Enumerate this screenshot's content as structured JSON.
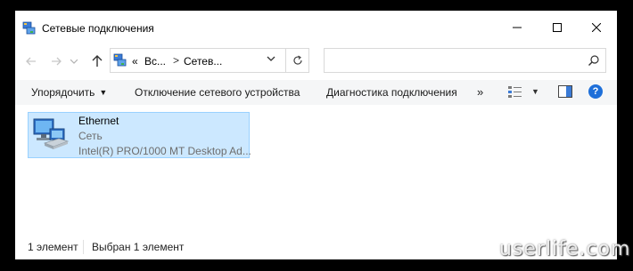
{
  "window": {
    "title": "Сетевые подключения",
    "icon": "network-connections-icon"
  },
  "address": {
    "overflow": "«",
    "segments": [
      "Вс...",
      "Сетев..."
    ],
    "separator": ">",
    "refresh_icon": "refresh-icon",
    "search_placeholder": ""
  },
  "toolbar": {
    "organize_label": "Упорядочить",
    "disable_label": "Отключение сетевого устройства",
    "diagnose_label": "Диагностика подключения",
    "more_label": "»",
    "help_label": "?"
  },
  "items": [
    {
      "name": "Ethernet",
      "network": "Сеть",
      "adapter": "Intel(R) PRO/1000 MT Desktop Ad..."
    }
  ],
  "status": {
    "count": "1 элемент",
    "selected": "Выбран 1 элемент"
  },
  "watermark": "userlife.com",
  "colors": {
    "selection_bg": "#cce8ff",
    "selection_border": "#99d1ff",
    "toolbar_bg": "#f5f6f7",
    "help_blue": "#1e6fd9"
  }
}
